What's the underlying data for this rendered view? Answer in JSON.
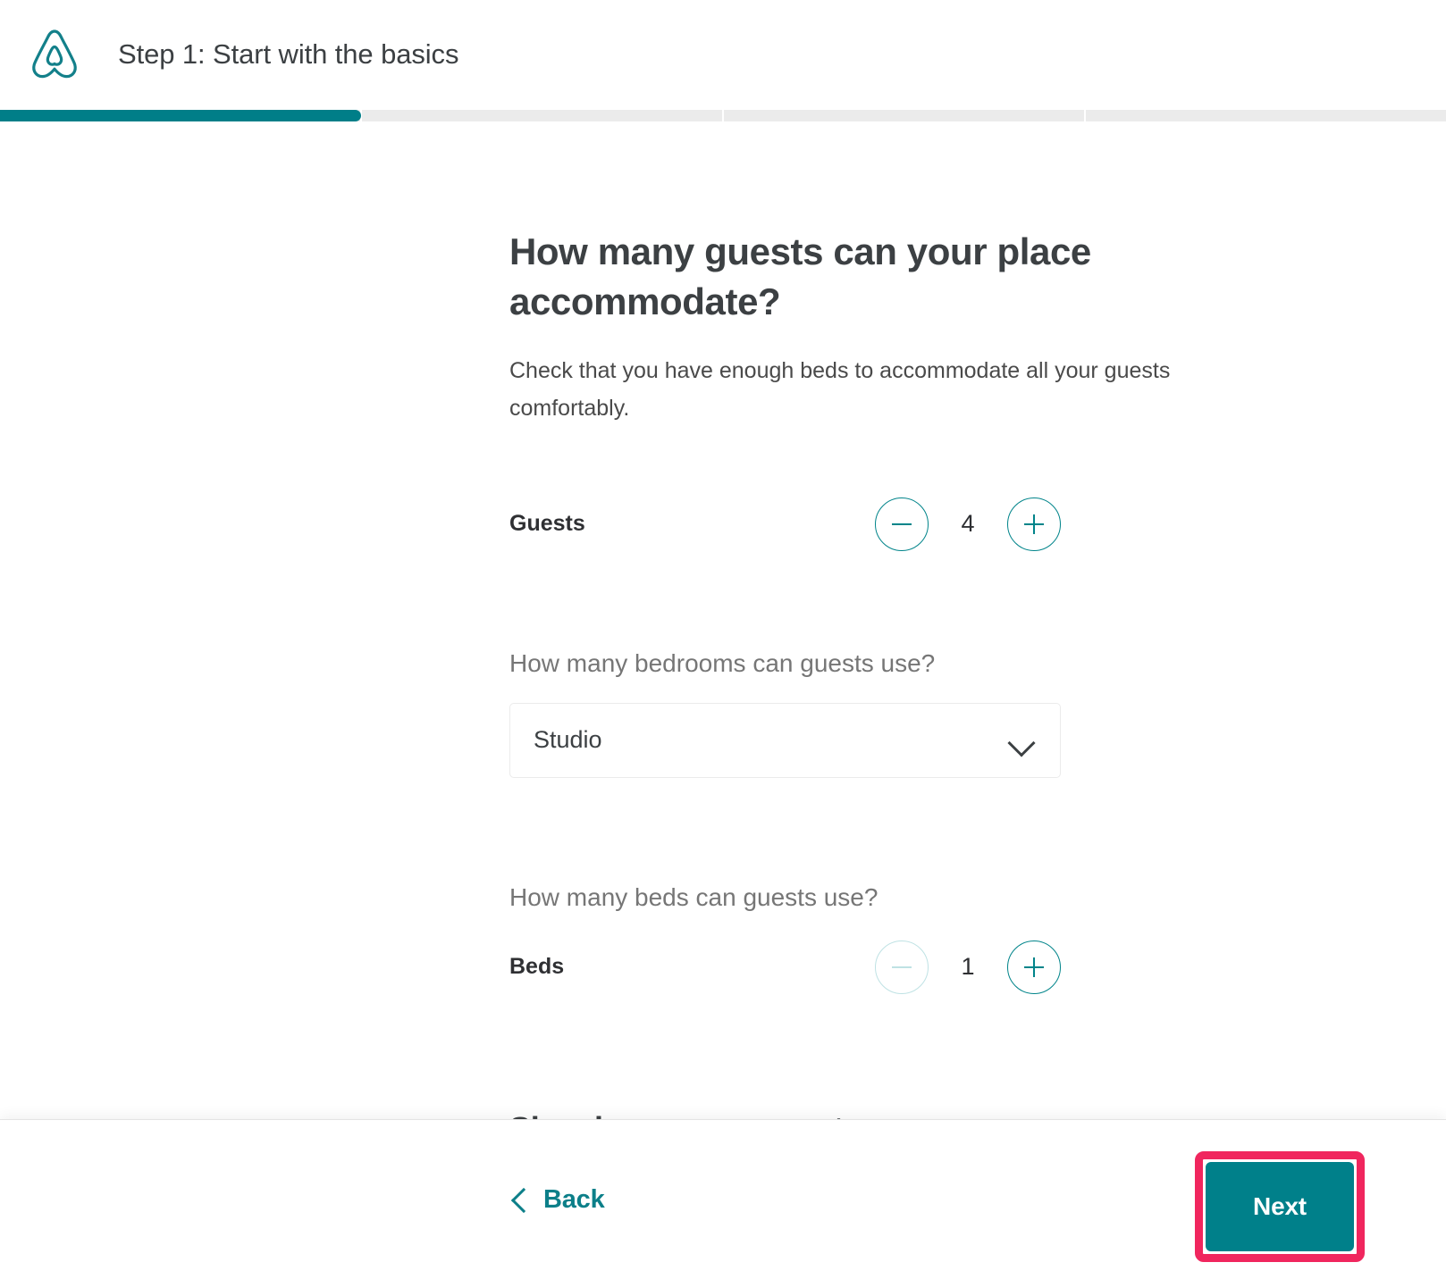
{
  "header": {
    "logo_name": "airbnb-logo",
    "step_title": "Step 1: Start with the basics"
  },
  "progress": {
    "segments": 4,
    "filled_percent": 25,
    "fill_color": "#007e88",
    "track_color": "#ebebeb"
  },
  "main": {
    "heading": "How many guests can your place accommodate?",
    "subheading": "Check that you have enough beds to accommodate all your guests comfortably.",
    "guests": {
      "label": "Guests",
      "value": "4",
      "decrement_label": "−",
      "increment_label": "+",
      "decrement_disabled": false,
      "increment_disabled": false
    },
    "bedrooms": {
      "question": "How many bedrooms can guests use?",
      "selected": "Studio",
      "chevron_name": "chevron-down-icon"
    },
    "beds": {
      "question": "How many beds can guests use?",
      "label": "Beds",
      "value": "1",
      "decrement_label": "−",
      "increment_label": "+",
      "decrement_disabled": true,
      "increment_disabled": false
    },
    "sleeping_arrangements_title": "Sleeping arrangements"
  },
  "footer": {
    "back_label": "Back",
    "back_chevron_name": "chevron-left-icon",
    "next_label": "Next",
    "next_highlight_color": "#f0265e",
    "next_button_color": "#00808a"
  },
  "colors": {
    "teal": "#00848a",
    "teal_dark": "#007e88",
    "pink_highlight": "#f0265e",
    "text_dark": "#3c4043",
    "text_muted": "#767676",
    "disabled_teal": "#bfe2e4"
  }
}
